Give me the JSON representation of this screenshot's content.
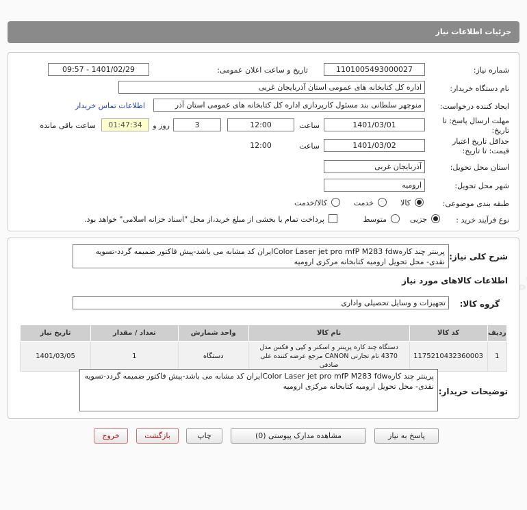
{
  "page": {
    "title": "جزئیات اطلاعات نیاز"
  },
  "fields": {
    "need_number_label": "شماره نیاز:",
    "need_number": "1101005493000027",
    "announce_label": "تاریخ و ساعت اعلان عمومی:",
    "announce_value": "1401/02/29 - 09:57",
    "buyer_org_label": "نام دستگاه خریدار:",
    "buyer_org": "اداره کل کتابخانه های عمومی استان آذربایجان غربی",
    "creator_label": "ایجاد کننده درخواست:",
    "creator": "منوچهر سلطانی بند مسئول کارپردازی اداره کل کتابخانه های عمومی استان آذر",
    "contact_link": "اطلاعات تماس خریدار",
    "reply_deadline_label_1": "مهلت ارسال پاسخ: تا",
    "reply_deadline_label_2": "تاریخ:",
    "reply_date": "1401/03/01",
    "time_label": "ساعت",
    "reply_time": "12:00",
    "days_value": "3",
    "days_label": "روز و",
    "remaining_time": "01:47:34",
    "remaining_label": "ساعت باقی مانده",
    "validity_label_1": "حداقل تاریخ اعتبار",
    "validity_label_2": "قیمت: تا تاریخ:",
    "validity_date": "1401/03/02",
    "validity_time_label": "ساعت",
    "validity_time": "12:00",
    "province_label": "استان محل تحویل:",
    "province": "آذربایجان غربی",
    "city_label": "شهر محل تحویل:",
    "city": "ارومیه",
    "category_label": "طبقه بندی موضوعی:",
    "category_options": [
      "کالا",
      "خدمت",
      "کالا/خدمت"
    ],
    "process_label": "نوع فرآیند خرید :",
    "process_options": [
      "جزیی",
      "متوسط"
    ],
    "payment_note": "پرداخت تمام یا بخشی از مبلغ خرید،از محل \"اسناد خزانه اسلامی\" خواهد بود."
  },
  "summary": {
    "label": "شرح کلی نیاز:",
    "text": "پرینتر چند کارهColor Laser jet pro mfP M283 fdwایران کد مشابه می باشد-پیش فاکتور ضمیمه گردد-تسویه نقدی- محل تحویل ارومیه کتابخانه مرکزی ارومیه"
  },
  "goods": {
    "section_title": "اطلاعات کالاهای مورد نیاز",
    "group_label": "گروه کالا:",
    "group_value": "تجهیزات و وسایل تحصیلی واداری",
    "headers": [
      "ردیف",
      "کد کالا",
      "نام کالا",
      "واحد شمارش",
      "تعداد / مقدار",
      "تاریخ نیاز"
    ],
    "rows": [
      [
        "1",
        "1175210432360003",
        "دستگاه چند کاره پرینتر و اسکنر و کپی و فکس مدل 4370 نام تجارتی CANON مرجع عرضه کننده علی صادقی",
        "دستگاه",
        "1",
        "1401/03/05"
      ]
    ]
  },
  "buyer_notes": {
    "label": "توضیحات خریدار:",
    "text": "پرینتر چند کارهColor Laser jet pro mfP M283 fdwایران کد مشابه می باشد-پیش فاکتور ضمیمه گردد-تسویه نقدی- محل تحویل ارومیه کتابخانه مرکزی ارومیه"
  },
  "buttons": {
    "reply": "پاسخ به نیاز",
    "attachments": "مشاهده مدارک پیوستی (0)",
    "print": "چاپ",
    "back": "بازگشت",
    "exit": "خروج"
  },
  "watermark": {
    "brand": "ParsNamadData",
    "tagline": "پایگاه اطلاع رسانی مناقصات و مزایدات پارس نماد داده"
  },
  "colors": {
    "title_bar": "#8a8a8a",
    "link": "#1a3fb5",
    "remaining_bg": "#ffffcc",
    "exit_text": "#b01010"
  }
}
